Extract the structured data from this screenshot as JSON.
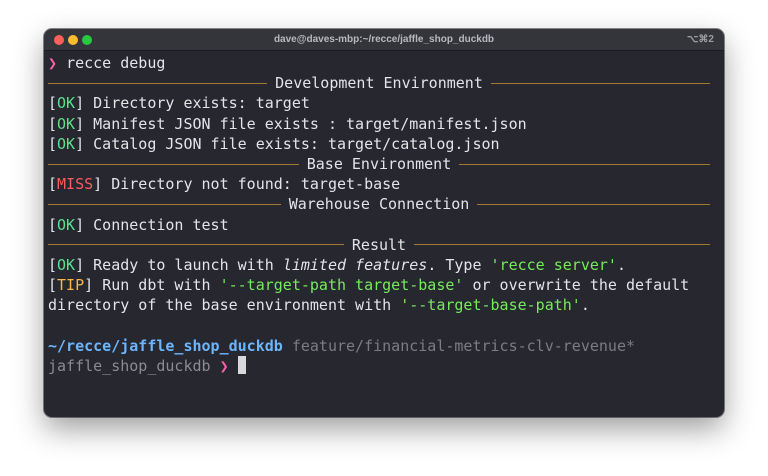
{
  "window": {
    "title": "dave@daves-mbp:~/recce/jaffle_shop_duckdb",
    "shortcut": "⌥⌘2"
  },
  "terminal": {
    "prompt_symbol": "❯",
    "command": "recce debug",
    "sections": {
      "dev": "Development Environment",
      "base": "Base Environment",
      "warehouse": "Warehouse Connection",
      "result": "Result"
    },
    "tags": {
      "ok": "OK",
      "miss": "MISS",
      "tip": "TIP"
    },
    "lines": {
      "dir_exists": "Directory exists: target",
      "manifest_exists": "Manifest JSON file exists : target/manifest.json",
      "catalog_exists": "Catalog JSON file exists: target/catalog.json",
      "dir_not_found": "Directory not found: target-base",
      "conn_test": "Connection test",
      "ready_a": "Ready to launch with ",
      "ready_em": "limited features",
      "ready_b": ". Type ",
      "ready_cmd": "'recce server'",
      "ready_c": ".",
      "tip_a": "Run dbt with ",
      "tip_flag1": "'--target-path target-base'",
      "tip_b": " or overwrite the default",
      "tip_c": "directory of the base environment with ",
      "tip_flag2": "'--target-base-path'",
      "tip_d": "."
    },
    "prompt": {
      "path": "~/recce/jaffle_shop_duckdb",
      "branch": "feature/financial-metrics-clv-revenue*",
      "venv": "jaffle_shop_duckdb",
      "symbol": "❯"
    }
  },
  "colors": {
    "background": "#26272f",
    "ok": "#5fe08a",
    "miss": "#ff5a60",
    "tip": "#ffb34d",
    "string": "#76ec5c",
    "path": "#6cb6ff",
    "prompt_arrow": "#ff5fa8",
    "rule": "#a8782f"
  }
}
